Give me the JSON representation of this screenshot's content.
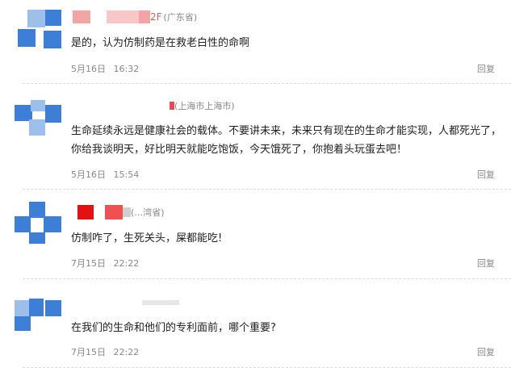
{
  "comments": [
    {
      "name_suffix": "2F",
      "location": "(广东省)",
      "text": "是的，认为仿制药是在救老白性的命啊",
      "date": "5月16日",
      "time": "16:32",
      "reply_label": "回复"
    },
    {
      "name_suffix": "",
      "location": "(上海市上海市)",
      "text": "生命延续永远是健康社会的载体。不要讲未来，未来只有现在的生命才能实现，人都死光了，你给我谈明天，好比明天就能吃饱饭，今天饿死了，你抱着头玩蛋去吧！",
      "date": "5月16日",
      "time": "15:54",
      "reply_label": "回复"
    },
    {
      "name_suffix": "",
      "location": "(…湾省)",
      "text": "仿制咋了，生死关头，屎都能吃!",
      "date": "7月15日",
      "time": "22:22",
      "reply_label": "回复"
    },
    {
      "name_suffix": "",
      "location": "",
      "text": "在我们的生命和他们的专利面前，哪个重要?",
      "date": "7月15日",
      "time": "22:22",
      "reply_label": "回复"
    }
  ]
}
